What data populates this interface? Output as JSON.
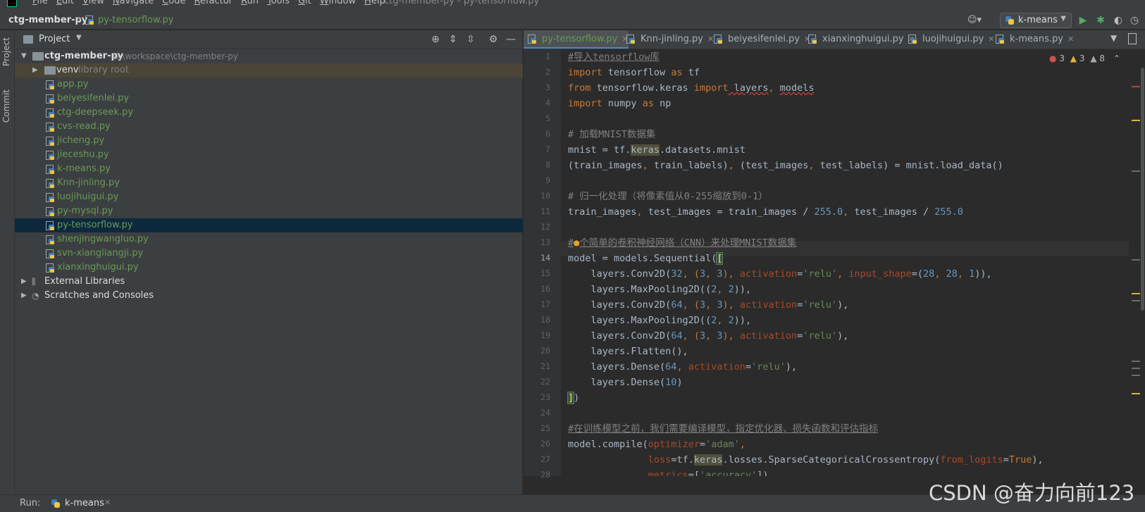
{
  "menubar": {
    "items": [
      "File",
      "Edit",
      "View",
      "Navigate",
      "Code",
      "Refactor",
      "Run",
      "Tools",
      "Git",
      "Window",
      "Help"
    ],
    "window_title": "ctg-member-py - py-tensorflow.py"
  },
  "navbar": {
    "project": "ctg-member-py",
    "file": "py-tensorflow.py",
    "run_config": "k-means"
  },
  "toolstrip": {
    "project_label": "Project",
    "commit_label": "Commit"
  },
  "project_panel": {
    "title": "Project",
    "root_name": "ctg-member-py",
    "root_path": "D:\\workspace\\ctg-member-py",
    "venv_name": "venv",
    "venv_note": "library root",
    "files": [
      "app.py",
      "beiyesifenlei.py",
      "ctg-deepseek.py",
      "cvs-read.py",
      "jicheng.py",
      "jieceshu.py",
      "k-means.py",
      "Knn-jinling.py",
      "luojihuigui.py",
      "py-mysql.py",
      "py-tensorflow.py",
      "shenjingwangluo.py",
      "svn-xiangliangji.py",
      "xianxinghuigui.py"
    ],
    "selected_file": "py-tensorflow.py",
    "external_libraries": "External Libraries",
    "scratches": "Scratches and Consoles"
  },
  "editor": {
    "tabs": [
      "py-tensorflow.py",
      "Knn-jinling.py",
      "beiyesifenlei.py",
      "xianxinghuigui.py",
      "luojihuigui.py",
      "k-means.py"
    ],
    "active_tab": "py-tensorflow.py",
    "inspections": {
      "errors": "3",
      "warnings": "3",
      "weak": "8"
    },
    "current_line": 14,
    "line_numbers": [
      "1",
      "2",
      "3",
      "4",
      "5",
      "6",
      "7",
      "8",
      "9",
      "10",
      "11",
      "12",
      "13",
      "14",
      "15",
      "16",
      "17",
      "18",
      "19",
      "20",
      "21",
      "22",
      "23",
      "24",
      "25",
      "26",
      "27",
      "28"
    ],
    "code": {
      "l1": "#导入tensorflow库",
      "l2_a": "import",
      "l2_b": " tensorflow ",
      "l2_c": "as",
      "l2_d": " tf",
      "l3_a": "from",
      "l3_b": " tensorflow.keras ",
      "l3_c": "import",
      "l3_d": " layers",
      "l3_e": ", ",
      "l3_f": "models",
      "l4_a": "import",
      "l4_b": " numpy ",
      "l4_c": "as",
      "l4_d": " np",
      "l6": "# 加载MNIST数据集",
      "l7_a": "mnist = tf.",
      "l7_b": "keras",
      "l7_c": ".datasets.mnist",
      "l8_a": "(train_images",
      "l8_b": ", ",
      "l8_c": "train_labels)",
      "l8_d": ", ",
      "l8_e": "(test_images",
      "l8_f": ", ",
      "l8_g": "test_labels) = mnist.load_data()",
      "l10": "# 归一化处理（将像素值从0-255缩放到0-1）",
      "l11_a": "train_images",
      "l11_b": ", ",
      "l11_c": "test_images = train_images / ",
      "l11_d": "255.0",
      "l11_e": ", ",
      "l11_f": "test_images / ",
      "l11_g": "255.0",
      "l13_a": "#",
      "l13_b": "个简单的卷积神经网络（CNN）来处理MNIST数据集",
      "l14_a": "model = models.Sequential(",
      "l14_b": "[",
      "l15_a": "    layers.Conv2D(",
      "l15_b": "32",
      "l15_c": ", (",
      "l15_d": "3",
      "l15_e": ", ",
      "l15_f": "3",
      "l15_g": "), ",
      "l15_h": "activation",
      "l15_i": "=",
      "l15_j": "'relu'",
      "l15_k": ", ",
      "l15_l": "input_shape",
      "l15_m": "=(",
      "l15_n": "28",
      "l15_o": ", ",
      "l15_p": "28",
      "l15_q": ", ",
      "l15_r": "1",
      "l15_s": ")),",
      "l16_a": "    layers.MaxPooling2D((",
      "l16_b": "2",
      "l16_c": ", ",
      "l16_d": "2",
      "l16_e": ")),",
      "l17_a": "    layers.Conv2D(",
      "l17_b": "64",
      "l17_c": ", (",
      "l17_d": "3",
      "l17_e": ", ",
      "l17_f": "3",
      "l17_g": "), ",
      "l17_h": "activation",
      "l17_i": "=",
      "l17_j": "'relu'",
      "l17_k": "),",
      "l18_a": "    layers.MaxPooling2D((",
      "l18_b": "2",
      "l18_c": ", ",
      "l18_d": "2",
      "l18_e": ")),",
      "l19_a": "    layers.Conv2D(",
      "l19_b": "64",
      "l19_c": ", (",
      "l19_d": "3",
      "l19_e": ", ",
      "l19_f": "3",
      "l19_g": "), ",
      "l19_h": "activation",
      "l19_i": "=",
      "l19_j": "'relu'",
      "l19_k": "),",
      "l20": "    layers.Flatten(),",
      "l21_a": "    layers.Dense(",
      "l21_b": "64",
      "l21_c": ", ",
      "l21_d": "activation",
      "l21_e": "=",
      "l21_f": "'relu'",
      "l21_g": "),",
      "l22_a": "    layers.Dense(",
      "l22_b": "10",
      "l22_c": ")",
      "l23_a": "]",
      "l23_b": ")",
      "l25": "#在训练模型之前，我们需要编译模型，指定优化器、损失函数和评估指标",
      "l26_a": "model.compile(",
      "l26_b": "optimizer",
      "l26_c": "=",
      "l26_d": "'adam'",
      "l26_e": ",",
      "l27_a": "              ",
      "l27_b": "loss",
      "l27_c": "=tf.",
      "l27_d": "keras",
      "l27_e": ".losses.SparseCategoricalCrossentropy(",
      "l27_f": "from_logits",
      "l27_g": "=",
      "l27_h": "True",
      "l27_i": "),",
      "l28_a": "              ",
      "l28_b": "metrics",
      "l28_c": "=[",
      "l28_d": "'accuracy'",
      "l28_e": "])"
    }
  },
  "runbar": {
    "label": "Run:",
    "config": "k-means"
  },
  "watermark": "CSDN @奋力向前123",
  "colors": {
    "keyword": "#cc7832",
    "number": "#6897bb",
    "string": "#6a8759",
    "comment": "#808080",
    "param": "#aa4926",
    "file_green": "#6a9a55",
    "selection": "#0d293e"
  }
}
